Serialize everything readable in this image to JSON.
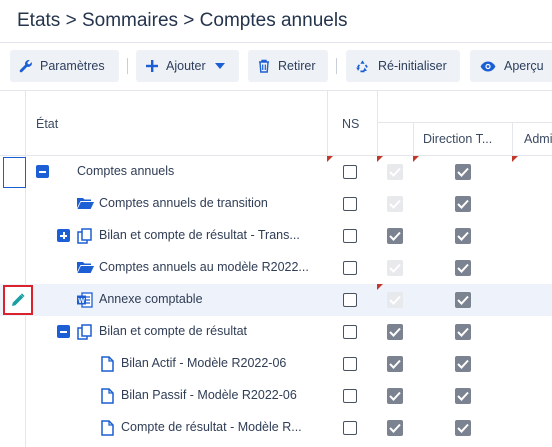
{
  "breadcrumb": "Etats > Sommaires > Comptes annuels",
  "toolbar": {
    "params": "Paramètres",
    "add": "Ajouter",
    "remove": "Retirer",
    "reset": "Ré-initialiser",
    "preview": "Aperçu"
  },
  "columns": {
    "state": "État",
    "ns": "NS",
    "direction": "Direction T...",
    "admin": "Admi"
  },
  "rows": [
    {
      "label": "Comptes annuels"
    },
    {
      "label": "Comptes annuels de transition"
    },
    {
      "label": "Bilan et compte de résultat - Trans..."
    },
    {
      "label": "Comptes annuels au modèle R2022..."
    },
    {
      "label": "Annexe comptable"
    },
    {
      "label": "Bilan et compte de résultat"
    },
    {
      "label": "Bilan Actif - Modèle R2022-06"
    },
    {
      "label": "Bilan Passif - Modèle R2022-06"
    },
    {
      "label": "Compte de résultat - Modèle R..."
    }
  ],
  "colors": {
    "accent": "#1c5fd4",
    "highlight_border": "#d9222c",
    "edit_icon": "#1a9fa3"
  }
}
